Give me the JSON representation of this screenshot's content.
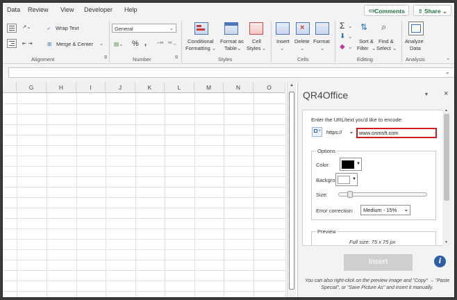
{
  "menubar": {
    "items": [
      "Data",
      "Review",
      "View",
      "Developer",
      "Help"
    ],
    "comments_label": "Comments",
    "share_label": "Share"
  },
  "ribbon": {
    "alignment": {
      "label": "Alignment",
      "wrap_text": "Wrap Text",
      "merge_center": "Merge & Center"
    },
    "number": {
      "label": "Number",
      "format_value": "General"
    },
    "styles": {
      "label": "Styles",
      "conditional_1": "Conditional",
      "conditional_2": "Formatting",
      "format_table_1": "Format as",
      "format_table_2": "Table",
      "cell_styles_1": "Cell",
      "cell_styles_2": "Styles"
    },
    "cells": {
      "label": "Cells",
      "insert": "Insert",
      "delete": "Delete",
      "format": "Format"
    },
    "editing": {
      "label": "Editing",
      "sort_1": "Sort &",
      "sort_2": "Filter",
      "find_1": "Find &",
      "find_2": "Select"
    },
    "analysis": {
      "label": "Analysis",
      "analyze_1": "Analyze",
      "analyze_2": "Data"
    }
  },
  "formula_bar": {
    "value": ""
  },
  "sheet": {
    "columns": [
      "G",
      "H",
      "I",
      "J",
      "K",
      "L",
      "M",
      "N",
      "O"
    ]
  },
  "taskpane": {
    "title": "QR4Office",
    "url_prompt": "Enter the URL/text you'd like to encode:",
    "protocol": "https://",
    "url_value": "www.onmsft.com",
    "options_legend": "Options",
    "color_label": "Color:",
    "background_label": "Background:",
    "size_label": "Size:",
    "size_value": 0.1,
    "error_label": "Error correction:",
    "error_value": "Medium - 15%",
    "preview_legend": "Preview",
    "full_size": "Full size: 75 x 75 px",
    "insert_label": "Insert",
    "hint_text": "You can also right-click on the preview image and \"Copy\" → \"Paste Special\", or \"Save Picture As\" and insert it manually.",
    "colors": {
      "foreground": "#000000",
      "background": "#ffffff",
      "url_highlight": "#d01c1c"
    }
  }
}
